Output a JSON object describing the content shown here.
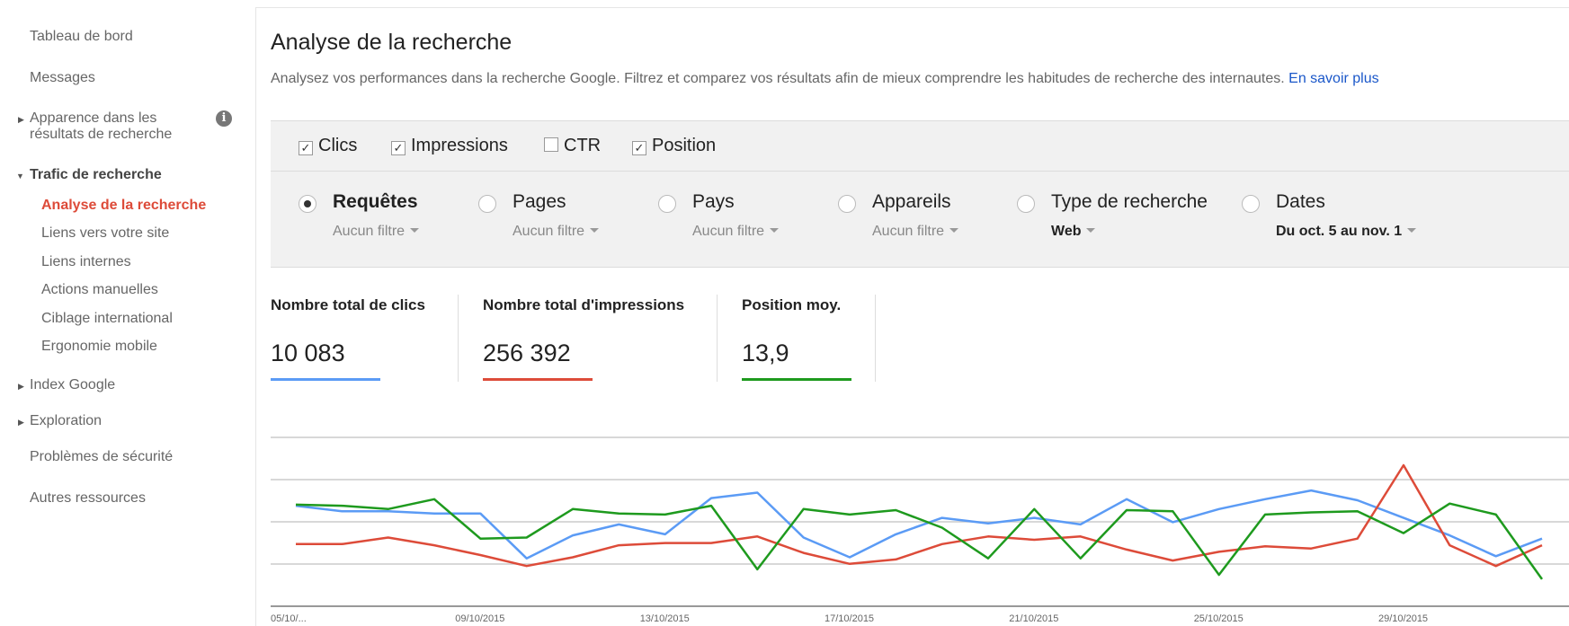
{
  "sidebar": {
    "items": [
      {
        "label": "Tableau de bord"
      },
      {
        "label": "Messages"
      },
      {
        "label": "Apparence dans les",
        "label2": "résultats de recherche"
      },
      {
        "label": "Trafic de recherche"
      },
      {
        "label": "Index Google"
      },
      {
        "label": "Exploration"
      },
      {
        "label": "Problèmes de sécurité"
      },
      {
        "label": "Autres ressources"
      }
    ],
    "sub_items": [
      {
        "label": "Analyse de la recherche"
      },
      {
        "label": "Liens vers votre site"
      },
      {
        "label": "Liens internes"
      },
      {
        "label": "Actions manuelles"
      },
      {
        "label": "Ciblage international"
      },
      {
        "label": "Ergonomie mobile"
      }
    ],
    "info_icon": "i"
  },
  "main": {
    "title": "Analyse de la recherche",
    "description": "Analysez vos performances dans la recherche Google. Filtrez et comparez vos résultats afin de mieux comprendre les habitudes de recherche des internautes.",
    "learn_more": "En savoir plus"
  },
  "metrics": [
    {
      "label": "Clics",
      "checked": true,
      "mark": "✓"
    },
    {
      "label": "Impressions",
      "checked": true,
      "mark": "✓"
    },
    {
      "label": "CTR",
      "checked": false,
      "mark": ""
    },
    {
      "label": "Position",
      "checked": true,
      "mark": "✓"
    }
  ],
  "dimensions": [
    {
      "label": "Requêtes",
      "selected": true,
      "filter": "Aucun filtre"
    },
    {
      "label": "Pages",
      "selected": false,
      "filter": "Aucun filtre"
    },
    {
      "label": "Pays",
      "selected": false,
      "filter": "Aucun filtre"
    },
    {
      "label": "Appareils",
      "selected": false,
      "filter": "Aucun filtre"
    },
    {
      "label": "Type de recherche",
      "selected": false,
      "filter": "Web"
    },
    {
      "label": "Dates",
      "selected": false,
      "filter": "Du oct. 5 au nov. 1"
    }
  ],
  "stats": [
    {
      "label": "Nombre total de clics",
      "value": "10 083",
      "color": "#5b9bf5"
    },
    {
      "label": "Nombre total d'impressions",
      "value": "256 392",
      "color": "#dd4b39"
    },
    {
      "label": "Position moy.",
      "value": "13,9",
      "color": "#1e9a1e"
    }
  ],
  "chart_data": {
    "type": "line",
    "x": [
      "05/10/2015",
      "06/10/2015",
      "07/10/2015",
      "08/10/2015",
      "09/10/2015",
      "10/10/2015",
      "11/10/2015",
      "12/10/2015",
      "13/10/2015",
      "14/10/2015",
      "15/10/2015",
      "16/10/2015",
      "17/10/2015",
      "18/10/2015",
      "19/10/2015",
      "20/10/2015",
      "21/10/2015",
      "22/10/2015",
      "23/10/2015",
      "24/10/2015",
      "25/10/2015",
      "26/10/2015",
      "27/10/2015",
      "28/10/2015",
      "29/10/2015",
      "30/10/2015",
      "31/10/2015",
      "01/11/2015"
    ],
    "x_tick_labels": [
      "05/10/...",
      "09/10/2015",
      "13/10/2015",
      "17/10/2015",
      "21/10/2015",
      "25/10/2015",
      "29/10/2015"
    ],
    "series": [
      {
        "name": "Clics",
        "color": "#5b9bf5",
        "values": [
          0.63,
          0.58,
          0.58,
          0.56,
          0.56,
          0.15,
          0.36,
          0.46,
          0.37,
          0.7,
          0.75,
          0.34,
          0.16,
          0.37,
          0.52,
          0.47,
          0.52,
          0.46,
          0.69,
          0.48,
          0.6,
          0.69,
          0.77,
          0.68,
          0.52,
          0.36,
          0.17,
          0.33
        ]
      },
      {
        "name": "Impressions",
        "color": "#dd4b39",
        "values": [
          0.28,
          0.28,
          0.34,
          0.27,
          0.18,
          0.08,
          0.16,
          0.27,
          0.29,
          0.29,
          0.35,
          0.2,
          0.1,
          0.14,
          0.28,
          0.35,
          0.32,
          0.35,
          0.23,
          0.13,
          0.21,
          0.26,
          0.24,
          0.33,
          1.0,
          0.27,
          0.08,
          0.27
        ]
      },
      {
        "name": "Position",
        "color": "#1e9a1e",
        "values": [
          0.64,
          0.63,
          0.6,
          0.69,
          0.33,
          0.34,
          0.6,
          0.56,
          0.55,
          0.63,
          0.05,
          0.6,
          0.55,
          0.59,
          0.43,
          0.15,
          0.6,
          0.15,
          0.59,
          0.58,
          0.0,
          0.55,
          0.57,
          0.58,
          0.38,
          0.65,
          0.55,
          -0.04
        ]
      }
    ],
    "xlabel": "",
    "ylabel": "",
    "grid": true
  }
}
